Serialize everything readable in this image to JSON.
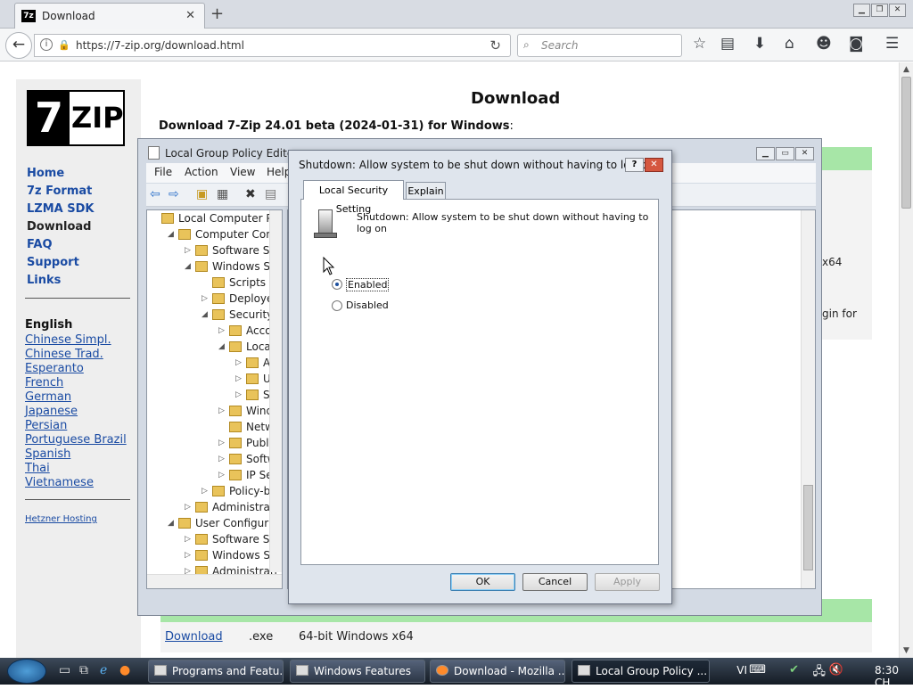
{
  "browser": {
    "tab_title": "Download",
    "tab_favicon": "7z",
    "url": "https://7-zip.org/download.html",
    "search_placeholder": "Search",
    "icons": [
      "back-arrow-icon",
      "info-icon",
      "lock-icon",
      "reload-icon",
      "search-icon",
      "bookmark-star-icon",
      "reading-list-icon",
      "download-arrow-icon",
      "home-icon",
      "chat-icon",
      "pocket-icon",
      "hamburger-menu-icon"
    ]
  },
  "page": {
    "logo_7": "7",
    "logo_zip": "ZIP",
    "heading": "Download",
    "subheading": "Download 7-Zip 24.01 beta (2024-01-31) for Windows",
    "subheading_colon": ":",
    "nav": [
      "Home",
      "7z Format",
      "LZMA SDK",
      "Download",
      "FAQ",
      "Support",
      "Links"
    ],
    "nav_current": "Download",
    "lang_current": "English",
    "languages": [
      "Chinese Simpl.",
      "Chinese Trad.",
      "Esperanto",
      "French",
      "German",
      "Japanese",
      "Persian",
      "Portuguese Brazil",
      "Spanish",
      "Thai",
      "Vietnamese"
    ],
    "hosting": "Hetzner Hosting",
    "partial_x64": "x64",
    "partial_login": "gin for",
    "row_link": "Download",
    "row_ext": ".exe",
    "row_desc": "64-bit Windows x64",
    "accent_green": "#a7e6a7"
  },
  "lgpe": {
    "title": "Local Group Policy Editor",
    "menu": [
      "File",
      "Action",
      "View",
      "Help"
    ],
    "tree": [
      {
        "label": "Local Computer Polic",
        "indent": 0,
        "tw": ""
      },
      {
        "label": "Computer Configu",
        "indent": 1,
        "tw": "◢"
      },
      {
        "label": "Software Setti",
        "indent": 2,
        "tw": "▷"
      },
      {
        "label": "Windows Sett",
        "indent": 2,
        "tw": "◢"
      },
      {
        "label": "Scripts (Sta",
        "indent": 3,
        "tw": ""
      },
      {
        "label": "Deployed",
        "indent": 3,
        "tw": "▷"
      },
      {
        "label": "Security Se",
        "indent": 3,
        "tw": "◢"
      },
      {
        "label": "Accou",
        "indent": 4,
        "tw": "▷"
      },
      {
        "label": "Local P",
        "indent": 4,
        "tw": "◢"
      },
      {
        "label": "Au",
        "indent": 5,
        "tw": "▷"
      },
      {
        "label": "Use",
        "indent": 5,
        "tw": "▷"
      },
      {
        "label": "Sec",
        "indent": 5,
        "tw": "▷"
      },
      {
        "label": "Windo",
        "indent": 4,
        "tw": "▷"
      },
      {
        "label": "Netwo",
        "indent": 4,
        "tw": ""
      },
      {
        "label": "Public",
        "indent": 4,
        "tw": "▷"
      },
      {
        "label": "Softwa",
        "indent": 4,
        "tw": "▷"
      },
      {
        "label": "IP Secu",
        "indent": 4,
        "tw": "▷"
      },
      {
        "label": "Policy-bas",
        "indent": 3,
        "tw": "▷"
      },
      {
        "label": "Administrative",
        "indent": 2,
        "tw": "▷"
      },
      {
        "label": "User Configuration",
        "indent": 1,
        "tw": "◢"
      },
      {
        "label": "Software Setti",
        "indent": 2,
        "tw": "▷"
      },
      {
        "label": "Windows Sett",
        "indent": 2,
        "tw": "▷"
      },
      {
        "label": "Administrati",
        "indent": 2,
        "tw": "▷"
      }
    ]
  },
  "dialog": {
    "title": "Shutdown: Allow system to be shut down without having to log on...",
    "help_btn": "?",
    "tabs": [
      "Local Security Setting",
      "Explain"
    ],
    "policy_name": "Shutdown: Allow system to be shut down without having to log on",
    "options": [
      {
        "label": "Enabled",
        "selected": true
      },
      {
        "label": "Disabled",
        "selected": false
      }
    ],
    "ok": "OK",
    "cancel": "Cancel",
    "apply": "Apply"
  },
  "taskbar": {
    "tasks": [
      "Programs and Featu...",
      "Windows Features",
      "Download - Mozilla ...",
      "Local Group Policy ..."
    ],
    "active_task": "Local Group Policy ...",
    "lang": "VI",
    "clock": "8:30 CH"
  }
}
